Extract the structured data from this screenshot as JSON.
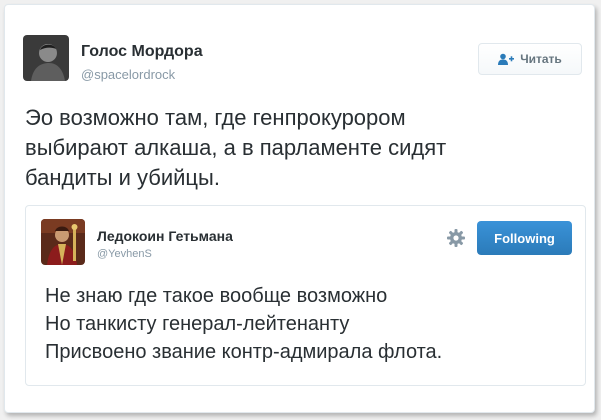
{
  "tweet": {
    "author": {
      "name": "Голос Мордора",
      "handle": "@spacelordrock",
      "avatar_icon": "person-avatar-icon"
    },
    "follow_button": {
      "label": "Читать",
      "icon": "follow-user-icon"
    },
    "text": "Эо возможно там, где генпрокурором\nвыбирают алкаша, а в парламенте сидят\nбандиты и убийцы."
  },
  "quoted_tweet": {
    "author": {
      "name": "Ледокоин Гетьмана",
      "handle": "@YevhenS",
      "avatar_icon": "portrait-avatar-icon"
    },
    "settings_icon": "gear-icon",
    "following_button": {
      "label": "Following",
      "color": "#2b7bb9"
    },
    "lines": [
      "Не знаю где такое вообще возможно",
      "Но танкисту генерал-лейтенанту",
      "Присвоено звание контр-адмирала флота."
    ]
  },
  "colors": {
    "background": "#f0f0f0",
    "card": "#ffffff",
    "text": "#292f33",
    "muted": "#8899a6",
    "accent": "#2b7bb9"
  }
}
